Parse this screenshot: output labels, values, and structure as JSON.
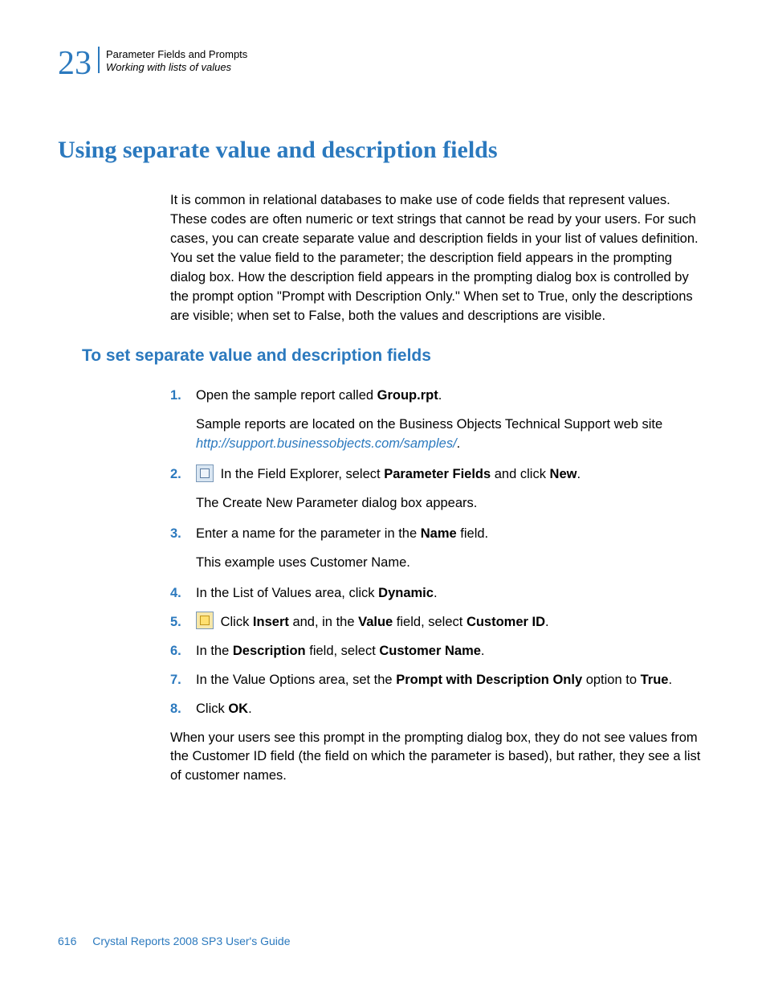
{
  "header": {
    "chapter_number": "23",
    "line1": "Parameter Fields and Prompts",
    "line2": "Working with lists of values"
  },
  "h1": "Using separate value and description fields",
  "intro": "It is common in relational databases to make use of code fields that represent values. These codes are often numeric or text strings that cannot be read by your users. For such cases, you can create separate value and description fields in your list of values definition. You set the value field to the parameter; the description field appears in the prompting dialog box. How the description field appears in the prompting dialog box is controlled by the prompt option \"Prompt with Description Only.\" When set to True, only the descriptions are visible; when set to False, both the values and descriptions are visible.",
  "h2": "To set separate value and description fields",
  "steps": {
    "s1": {
      "num": "1.",
      "a": "Open the sample report called ",
      "b": "Group.rpt",
      "c": "."
    },
    "s1sub": {
      "a": "Sample reports are located on the Business Objects Technical Support web site ",
      "link": "http://support.businessobjects.com/samples/",
      "b": "."
    },
    "s2": {
      "num": "2.",
      "a": " In the Field Explorer, select ",
      "b": "Parameter Fields",
      "c": " and click ",
      "d": "New",
      "e": "."
    },
    "s2sub": "The Create New Parameter dialog box appears.",
    "s3": {
      "num": "3.",
      "a": "Enter a name for the parameter in the ",
      "b": "Name",
      "c": " field."
    },
    "s3sub": "This example uses Customer Name.",
    "s4": {
      "num": "4.",
      "a": "In the List of Values area, click ",
      "b": "Dynamic",
      "c": "."
    },
    "s5": {
      "num": "5.",
      "a": " Click ",
      "b": "Insert",
      "c": " and, in the ",
      "d": "Value",
      "e": " field, select ",
      "f": "Customer ID",
      "g": "."
    },
    "s6": {
      "num": "6.",
      "a": "In the ",
      "b": "Description",
      "c": " field, select ",
      "d": "Customer Name",
      "e": "."
    },
    "s7": {
      "num": "7.",
      "a": "In the Value Options area, set the ",
      "b": "Prompt with Description Only",
      "c": " option to ",
      "d": "True",
      "e": "."
    },
    "s8": {
      "num": "8.",
      "a": "Click ",
      "b": "OK",
      "c": "."
    }
  },
  "closing": "When your users see this prompt in the prompting dialog box, they do not see values from the Customer ID field (the field on which the parameter is based), but rather, they see a list of customer names.",
  "footer": {
    "page": "616",
    "title": "Crystal Reports 2008 SP3 User's Guide"
  }
}
